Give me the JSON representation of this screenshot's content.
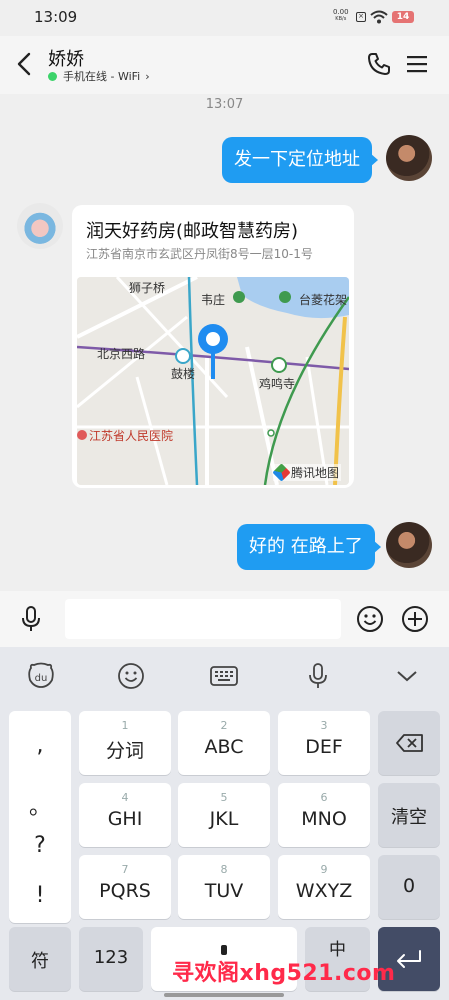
{
  "status_bar": {
    "time": "13:09",
    "net_speed": "0.00",
    "net_unit": "KB/s",
    "battery": "14"
  },
  "header": {
    "contact_name": "娇娇",
    "online_status": "手机在线 - WiFi"
  },
  "chat": {
    "timestamp": "13:07",
    "messages": [
      {
        "from": "me",
        "text": "发一下定位地址"
      },
      {
        "from": "friend",
        "type": "location",
        "title": "润天好药房(邮政智慧药房)",
        "address": "江苏省南京市玄武区丹凤街8号一层10-1号",
        "map_labels": {
          "poi1": "狮子桥",
          "poi2": "韦庄",
          "poi3": "台菱花架",
          "road": "北京西路",
          "station1": "鼓楼",
          "station2": "鸡鸣寺",
          "hospital": "江苏省人民医院"
        },
        "map_brand": "腾讯地图"
      },
      {
        "from": "me",
        "text": "好的 在路上了"
      }
    ]
  },
  "keyboard": {
    "punct": [
      ",",
      "。",
      "?",
      "!"
    ],
    "keys": [
      {
        "num": "1",
        "label": "分词"
      },
      {
        "num": "2",
        "label": "ABC"
      },
      {
        "num": "3",
        "label": "DEF"
      },
      {
        "num": "4",
        "label": "GHI"
      },
      {
        "num": "5",
        "label": "JKL"
      },
      {
        "num": "6",
        "label": "MNO"
      },
      {
        "num": "7",
        "label": "PQRS"
      },
      {
        "num": "8",
        "label": "TUV"
      },
      {
        "num": "9",
        "label": "WXYZ"
      }
    ],
    "clear": "清空",
    "zero": "0",
    "symbol": "符",
    "num123": "123",
    "lang": "中"
  },
  "watermark": "寻欢阁xhg521.com",
  "colors": {
    "bubble_me": "#1f9cf2",
    "online_dot": "#3cd36a",
    "enter_key": "#434c66"
  }
}
